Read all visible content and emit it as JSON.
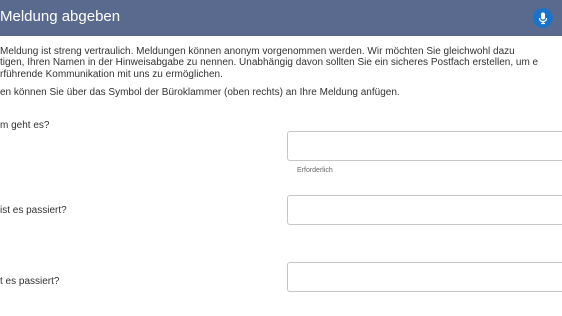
{
  "header": {
    "title": "Meldung abgeben",
    "mic_icon": "microphone-icon"
  },
  "intro": {
    "line1": "Meldung ist streng vertraulich. Meldungen können anonym vorgenommen werden. Wir möchten Sie gleichwohl dazu",
    "line2": "tigen, Ihren Namen in der Hinweisabgabe zu nennen. Unabhängig davon sollten Sie ein sicheres Postfach erstellen, um e",
    "line3": "rführende Kommunikation mit uns zu ermöglichen.",
    "line4": "en können Sie über das Symbol der Büroklammer (oben rechts) an Ihre Meldung anfügen."
  },
  "form": {
    "q1_label": "m geht es?",
    "q1_hint": "Erforderlich",
    "q2_label": "ist es passiert?",
    "q3_label": "t es passiert?"
  },
  "colors": {
    "header_bg": "#5a6a8e",
    "mic_bg": "#1a73c8"
  }
}
